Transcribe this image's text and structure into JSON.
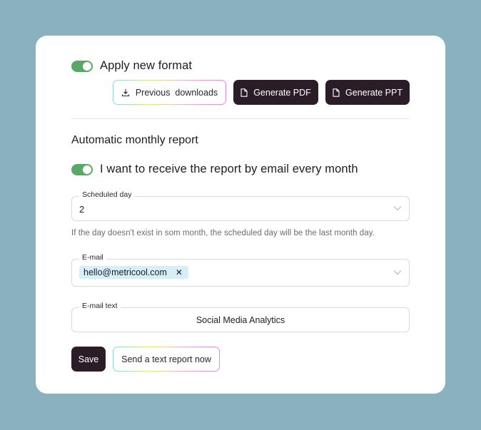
{
  "format": {
    "toggle_label": "Apply new format",
    "toggle_on": true,
    "previous_downloads_label": "Previous  downloads",
    "generate_pdf_label": "Generate PDF",
    "generate_ppt_label": "Generate PPT"
  },
  "monthly": {
    "section_title": "Automatic monthly report",
    "email_toggle_label": "I want to receive the report by email every month",
    "email_toggle_on": true,
    "scheduled_day": {
      "legend": "Scheduled day",
      "value": "2"
    },
    "helper_text": "If the day doesn't exist in som month, the scheduled day will be the last month day.",
    "email": {
      "legend": "E-mail",
      "chip": "hello@metricool.com"
    },
    "email_text": {
      "legend": "E-mail text",
      "value": "Social Media Analytics"
    },
    "save_label": "Save",
    "send_now_label": "Send a text report now"
  },
  "colors": {
    "background": "#8ab1be",
    "card": "#ffffff",
    "toggle_on": "#5aa868",
    "dark_button": "#2a1d27",
    "chip": "#d6eef8"
  }
}
